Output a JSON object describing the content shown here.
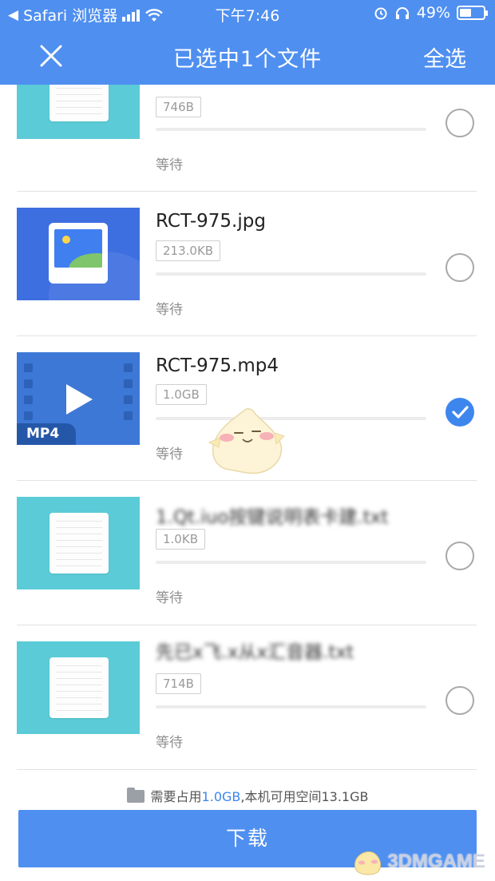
{
  "status_bar": {
    "carrier": "Safari 浏览器",
    "time": "下午7:46",
    "battery": "49%",
    "battery_level": 0.49
  },
  "nav": {
    "title": "已选中1个文件",
    "select_all": "全选"
  },
  "files": [
    {
      "name": "",
      "size": "746B",
      "status": "等待",
      "type": "doc",
      "selected": false
    },
    {
      "name": "RCT-975.jpg",
      "size": "213.0KB",
      "status": "等待",
      "type": "image",
      "selected": false
    },
    {
      "name": "RCT-975.mp4",
      "size": "1.0GB",
      "status": "等待",
      "type": "video",
      "thumb_label": "MP4",
      "selected": true
    },
    {
      "name": "1.Qt.iuo按键说明表卡建.txt",
      "size": "1.0KB",
      "status": "等待",
      "type": "doc",
      "selected": false
    },
    {
      "name": "先已x飞.x从x汇音器.txt",
      "size": "714B",
      "status": "等待",
      "type": "doc",
      "selected": false
    }
  ],
  "footer": {
    "required_prefix": "需要占用",
    "required_value": "1.0GB",
    "available_text": ",本机可用空间13.1GB",
    "download_label": "下载"
  },
  "watermark": {
    "text": "3DMGAME"
  },
  "colors": {
    "primary": "#4f8ff0",
    "check": "#3d86ee",
    "doc_thumb": "#5bcbd7",
    "image_thumb": "#3e6fe0",
    "video_thumb": "#3d78d6"
  }
}
